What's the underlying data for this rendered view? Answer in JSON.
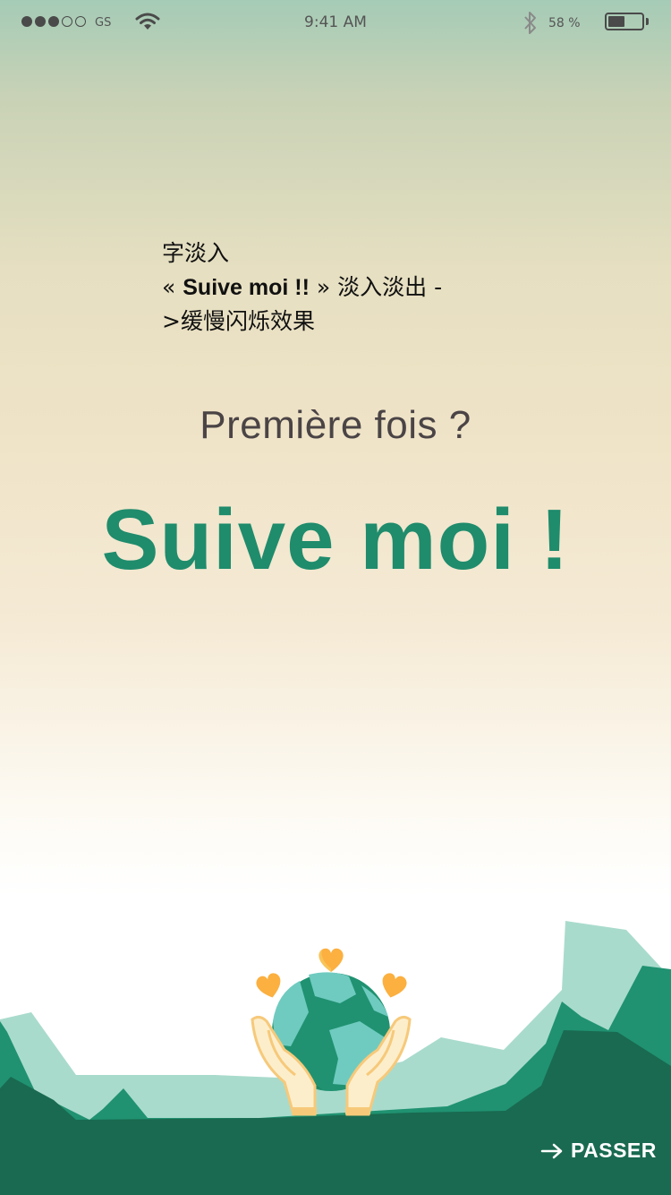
{
  "status_bar": {
    "signal_dots": [
      "on",
      "on",
      "on",
      "off",
      "off"
    ],
    "carrier": "GS",
    "time": "9:41 AM",
    "battery_percent_text": "58 %",
    "battery_level": 0.45
  },
  "note": {
    "line1": "字淡入",
    "line2_open": "« ",
    "line2_bold": "Suive moi !!",
    "line2_close": " » 淡入淡出 -",
    "line3": ">缓慢闪烁效果"
  },
  "main": {
    "question": "Première fois ?",
    "headline": "Suive moi !"
  },
  "footer": {
    "skip_label": "PASSER"
  },
  "colors": {
    "accent": "#1f8c6c",
    "dark_green": "#196a50",
    "mint": "#a9dbcc",
    "heart": "#fbb040"
  }
}
